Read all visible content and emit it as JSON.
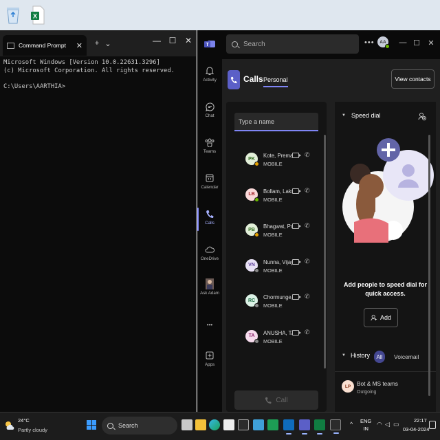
{
  "desktop": {
    "icons": [
      "recycle-bin-icon",
      "excel-file-icon"
    ]
  },
  "cmd": {
    "tab_title": "Command Prompt",
    "new_tab": "+",
    "dropdown": "⌄",
    "lines": [
      "Microsoft Windows [Version 10.0.22631.3296]",
      "(c) Microsoft Corporation. All rights reserved.",
      "",
      "C:\\Users\\AARTHIA>"
    ]
  },
  "teams": {
    "search_placeholder": "Search",
    "avatar_initials": "AA",
    "rail": [
      {
        "label": "Activity"
      },
      {
        "label": "Chat"
      },
      {
        "label": "Teams"
      },
      {
        "label": "Calendar"
      },
      {
        "label": "Calls"
      },
      {
        "label": "OneDrive"
      },
      {
        "label": "Ask Adam"
      },
      {
        "label": "•••"
      },
      {
        "label": "Apps"
      }
    ],
    "header": {
      "title": "Calls",
      "tab": "Personal",
      "view_contacts": "View contacts"
    },
    "contacts": {
      "input_placeholder": "Type a name",
      "items": [
        {
          "initials": "PK",
          "name": "Kote, Prema",
          "sub": "MOBILE",
          "bg": "#e2efd9",
          "fg": "#2f6b1d",
          "status": "#e5a100"
        },
        {
          "initials": "LB",
          "name": "Bollam, Laks...",
          "sub": "MOBILE",
          "bg": "#fbdada",
          "fg": "#a4262c",
          "status": "#6bb700"
        },
        {
          "initials": "PB",
          "name": "Bhagwat, Priti",
          "sub": "MOBILE",
          "bg": "#e2efd9",
          "fg": "#2f6b1d",
          "status": "#e5a100"
        },
        {
          "initials": "VN",
          "name": "Nunna, Vijay...",
          "sub": "MOBILE",
          "bg": "#e8e1f5",
          "fg": "#5c3d99",
          "status": "#888888"
        },
        {
          "initials": "RC",
          "name": "Chormunge, ...",
          "sub": "MOBILE",
          "bg": "#dcf2e6",
          "fg": "#1f6d44",
          "status": "#888888"
        },
        {
          "initials": "TA",
          "name": "ANUSHA, TA...",
          "sub": "MOBILE",
          "bg": "#f7dcee",
          "fg": "#8a2169",
          "status": "#888888"
        }
      ],
      "call_button": "Call"
    },
    "speed_dial": {
      "title": "Speed dial",
      "message": "Add people to speed dial for quick access.",
      "add_button": "Add"
    },
    "history": {
      "title": "History",
      "filter_all": "All",
      "filter_voicemail": "Voicemail",
      "items": [
        {
          "initials": "LP",
          "name": "Bot & MS teams",
          "sub": "Outgoing"
        }
      ]
    }
  },
  "taskbar": {
    "weather_temp": "24°C",
    "weather_desc": "Partly cloudy",
    "search_label": "Search",
    "lang_top": "ENG",
    "lang_bottom": "IN",
    "time": "22:17",
    "date": "03-04-2024",
    "tray_chevron": "^"
  }
}
